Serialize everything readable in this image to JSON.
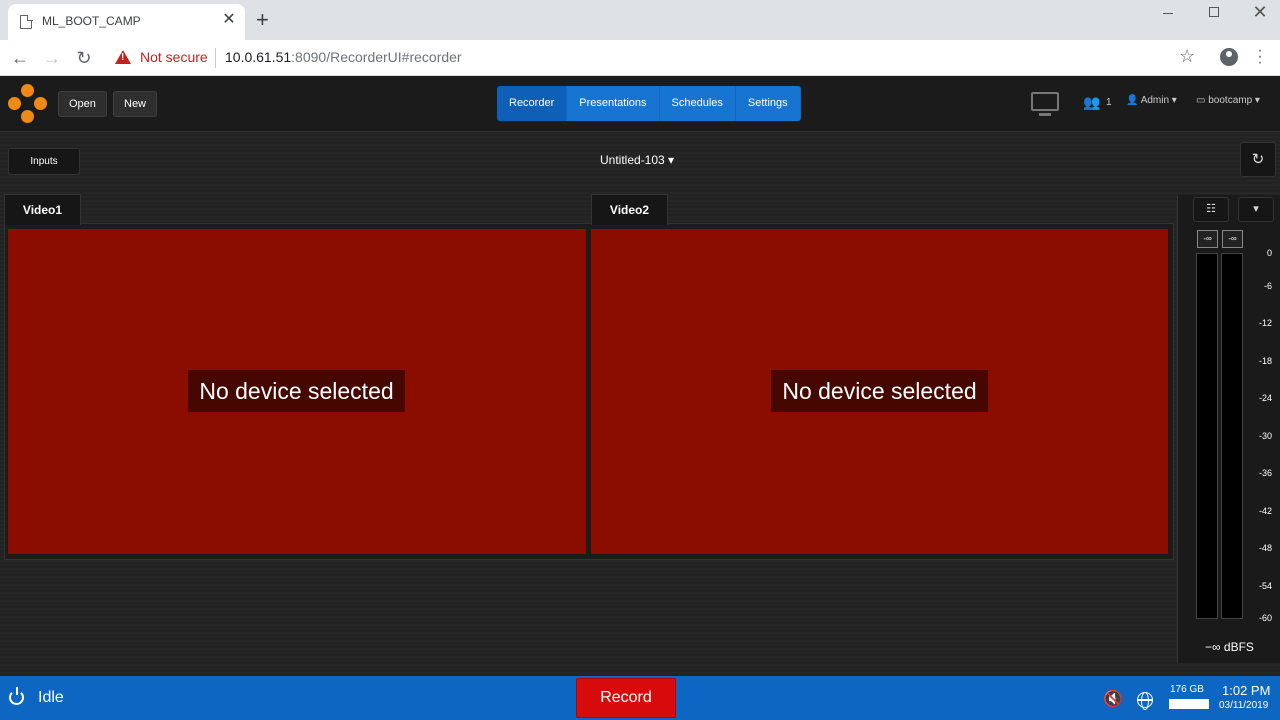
{
  "browser": {
    "tab_title": "ML_BOOT_CAMP",
    "tab_close": "✕",
    "new_tab": "+",
    "security_label": "Not secure",
    "url_host": "10.0.61.51",
    "url_rest": ":8090/RecorderUI#recorder"
  },
  "header": {
    "open_label": "Open",
    "new_label": "New",
    "nav_tabs": [
      "Recorder",
      "Presentations",
      "Schedules",
      "Settings"
    ],
    "active_tab": "Recorder",
    "users_count": "1",
    "user_label": "Admin ▾",
    "workspace_label": "bootcamp ▾"
  },
  "workspace": {
    "inputs_label": "Inputs",
    "session_title": "Untitled-103 ▾",
    "refresh_icon": "↻"
  },
  "videos": [
    {
      "tab": "Video1",
      "message": "No device selected"
    },
    {
      "tab": "Video2",
      "message": "No device selected"
    }
  ],
  "meter": {
    "settings_icon": "☷",
    "dropdown_icon": "▾",
    "peak_left": "-∞",
    "peak_right": "-∞",
    "scale": [
      "0",
      "-6",
      "-12",
      "-18",
      "-24",
      "-30",
      "-36",
      "-42",
      "-48",
      "-54",
      "-60"
    ],
    "readout": "−∞ dBFS"
  },
  "status": {
    "state": "Idle",
    "record_label": "Record",
    "disk_free": "176 GB",
    "time": "1:02 PM",
    "date": "03/11/2019"
  },
  "colors": {
    "accent_blue": "#1775d1",
    "status_blue": "#0d67c2",
    "video_red": "#8b0d00",
    "record_red": "#d70b0b",
    "logo_orange": "#f08a17"
  }
}
